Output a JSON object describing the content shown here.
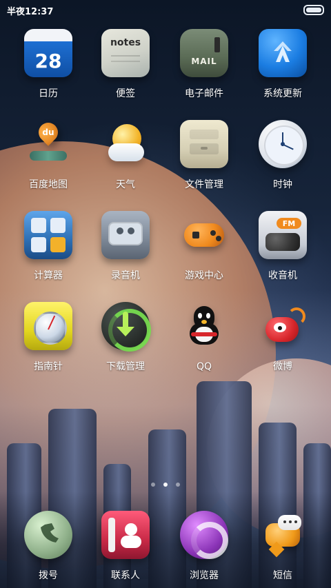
{
  "status_bar": {
    "time": "半夜12:37"
  },
  "grid": [
    [
      {
        "name": "calendar",
        "label": "日历",
        "icon": "calendar-icon",
        "badge": "28"
      },
      {
        "name": "notes",
        "label": "便签",
        "icon": "notes-icon",
        "badge": "notes"
      },
      {
        "name": "email",
        "label": "电子邮件",
        "icon": "mailbox-icon",
        "badge": "MAIL"
      },
      {
        "name": "system-update",
        "label": "系统更新",
        "icon": "system-update-icon"
      }
    ],
    [
      {
        "name": "baidu-map",
        "label": "百度地图",
        "icon": "map-pin-icon",
        "badge": "du"
      },
      {
        "name": "weather",
        "label": "天气",
        "icon": "weather-icon"
      },
      {
        "name": "file-manager",
        "label": "文件管理",
        "icon": "file-cabinet-icon"
      },
      {
        "name": "clock",
        "label": "时钟",
        "icon": "clock-icon"
      }
    ],
    [
      {
        "name": "calculator",
        "label": "计算器",
        "icon": "calculator-icon"
      },
      {
        "name": "recorder",
        "label": "录音机",
        "icon": "cassette-icon"
      },
      {
        "name": "game-center",
        "label": "游戏中心",
        "icon": "gamepad-icon"
      },
      {
        "name": "radio",
        "label": "收音机",
        "icon": "radio-icon",
        "badge": "FM"
      }
    ],
    [
      {
        "name": "compass",
        "label": "指南针",
        "icon": "compass-icon"
      },
      {
        "name": "download-manager",
        "label": "下载管理",
        "icon": "download-icon"
      },
      {
        "name": "qq",
        "label": "QQ",
        "icon": "qq-penguin-icon"
      },
      {
        "name": "weibo",
        "label": "微博",
        "icon": "weibo-icon"
      }
    ]
  ],
  "pager": {
    "count": 3,
    "active": 2
  },
  "dock": [
    {
      "name": "dialer",
      "label": "拨号",
      "icon": "phone-icon"
    },
    {
      "name": "contacts",
      "label": "联系人",
      "icon": "contacts-book-icon"
    },
    {
      "name": "browser",
      "label": "浏览器",
      "icon": "browser-icon"
    },
    {
      "name": "messages",
      "label": "短信",
      "icon": "message-bubble-icon"
    }
  ],
  "colors": {
    "calendar": "#1e6fd2",
    "notes": "#cfd2c9",
    "mail": "#5a6b55",
    "system_update": "#1b7de2",
    "map": "#e58a27",
    "weather": "#f3b52a",
    "files": "#d7d1b6",
    "clock": "#d7dde6",
    "calculator": "#2d6fb4",
    "recorder": "#7c8796",
    "gamepad": "#f08a1e",
    "radio": "#f08a1e",
    "compass": "#e2d61f",
    "download": "#2a2f2c",
    "qq": "#111111",
    "weibo": "#d7262b",
    "dialer": "#8fb08a",
    "contacts": "#c92a47",
    "browser": "#8a33b6",
    "messages": "#f09a1a"
  }
}
